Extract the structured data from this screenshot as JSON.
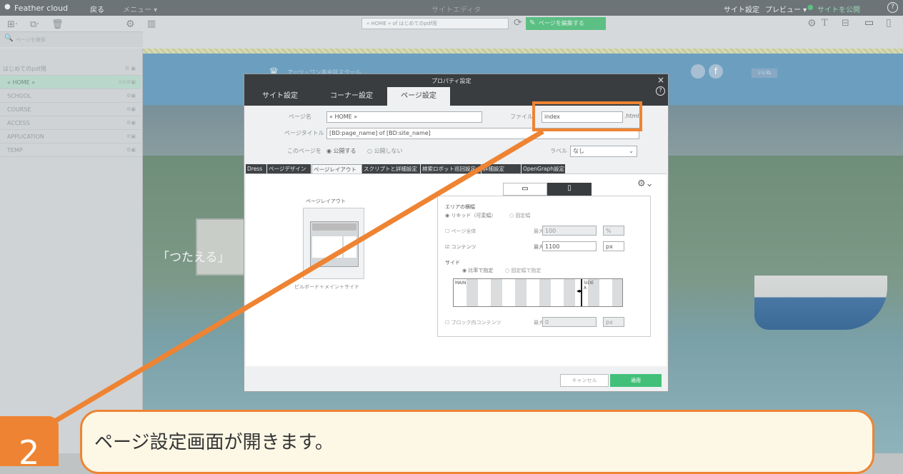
{
  "topbar": {
    "logo": "Feather cloud",
    "back": "戻る",
    "menu": "メニュー ▾",
    "center_title": "サイトエディタ",
    "site_settings": "サイト設定",
    "preview": "プレビュー ▾",
    "publish": "サイトを公開",
    "help": "?"
  },
  "toolbar": {
    "url": "« HOME » of はじめてのpdf用",
    "edit_page": "ページを編集する",
    "search_placeholder": "ページを検索",
    "ot_label": "T"
  },
  "sidebar": {
    "root": "はじめてのpdf用",
    "items": [
      {
        "label": "« HOME »",
        "active": true
      },
      {
        "label": "SCHOOL"
      },
      {
        "label": "COURSE"
      },
      {
        "label": "ACCESS"
      },
      {
        "label": "APPLICATION"
      },
      {
        "label": "TEMP"
      }
    ]
  },
  "page": {
    "brand": "アーツ・ワン英会話スクール",
    "fb_label": "f",
    "like_label": "いいね",
    "hero_text": "「つたえる」"
  },
  "dialog": {
    "title": "プロパティ設定",
    "tabs": [
      "サイト設定",
      "コーナー設定",
      "ページ設定"
    ],
    "page_name_label": "ページ名",
    "page_name": "« HOME »",
    "file_label": "ファイル",
    "file_value": "index",
    "file_ext": ".html",
    "page_title_label": "ページタイトル",
    "page_title": "[BD:page_name] of [BD:site_name]",
    "publish_label": "このページを",
    "publish_on": "公開する",
    "publish_off": "公開しない",
    "label_label": "ラベル",
    "label_value": "なし",
    "subtabs": [
      "Dress",
      "ページデザイン",
      "ページレイアウト",
      "スクリプトと詳細設定",
      "検索ロボット巡回設定",
      "詳細設定",
      "OpenGraph設定"
    ],
    "layout_title": "ページレイアウト",
    "layout_caption": "ビルボード＋メイン＋サイド",
    "area_width": "エリアの横幅",
    "liquid": "リキッド（可変幅）",
    "fixed": "固定幅",
    "page_full": "ページ全体",
    "max": "最大",
    "page_full_val": "100",
    "page_full_unit": "%",
    "contents": "コンテンツ",
    "contents_val": "1100",
    "contents_unit": "px",
    "side": "サイド",
    "side_ratio": "比率で指定",
    "side_fixed": "固定幅で指定",
    "main_label": "MAIN",
    "side_label": "SIDE A",
    "block_contents": "ブロック内コンテンツ",
    "block_val": "0",
    "block_unit": "px",
    "cancel": "キャンセル",
    "apply": "適用"
  },
  "callout": {
    "step": "2",
    "text": "ページ設定画面が開きます。"
  },
  "colors": {
    "accent": "#ee8433",
    "apply": "#42c07a",
    "edit_btn": "#5cbf84"
  }
}
